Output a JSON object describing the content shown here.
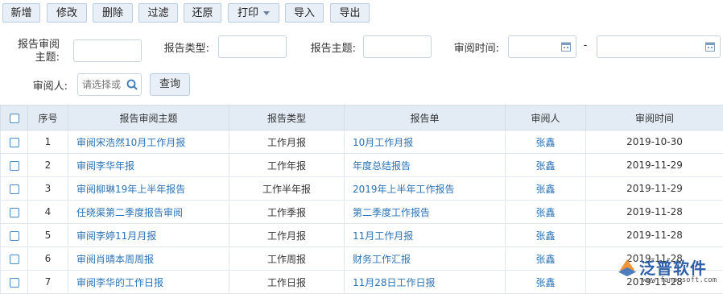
{
  "toolbar": {
    "buttons": [
      "新增",
      "修改",
      "删除",
      "过滤",
      "还原",
      "打印",
      "导入",
      "导出"
    ]
  },
  "filters": {
    "subject_label": "报告审阅主题:",
    "type_label": "报告类型:",
    "topic_label": "报告主题:",
    "time_label": "审阅时间:",
    "range_sep": "-",
    "reviewer_label": "审阅人:",
    "reviewer_placeholder": "请选择或",
    "query_button": "查询"
  },
  "table": {
    "headers": [
      "序号",
      "报告审阅主题",
      "报告类型",
      "报告单",
      "审阅人",
      "审阅时间"
    ],
    "rows": [
      {
        "no": "1",
        "subject": "审阅宋浩然10月工作月报",
        "type": "工作月报",
        "report": "10月工作月报",
        "reviewer": "张鑫",
        "time": "2019-10-30"
      },
      {
        "no": "2",
        "subject": "审阅李华年报",
        "type": "工作年报",
        "report": "年度总结报告",
        "reviewer": "张鑫",
        "time": "2019-11-29"
      },
      {
        "no": "3",
        "subject": "审阅柳琳19年上半年报告",
        "type": "工作半年报",
        "report": "2019年上半年工作报告",
        "reviewer": "张鑫",
        "time": "2019-11-29"
      },
      {
        "no": "4",
        "subject": "任晓渠第二季度报告审阅",
        "type": "工作季报",
        "report": "第二季度工作报告",
        "reviewer": "张鑫",
        "time": "2019-11-28"
      },
      {
        "no": "5",
        "subject": "审阅李婷11月月报",
        "type": "工作月报",
        "report": "11月工作月报",
        "reviewer": "张鑫",
        "time": "2019-11-28"
      },
      {
        "no": "6",
        "subject": "审阅肖晴本周周报",
        "type": "工作周报",
        "report": "财务工作汇报",
        "reviewer": "张鑫",
        "time": "2019-11-28"
      },
      {
        "no": "7",
        "subject": "审阅李华的工作日报",
        "type": "工作日报",
        "report": "11月28日工作日报",
        "reviewer": "张鑫",
        "time": "2019-11-28"
      }
    ]
  },
  "watermark": {
    "name": "泛普软件",
    "url": "www.fanpusoft.com"
  },
  "colors": {
    "link": "#2a73b6",
    "header_bg": "#e3ecf5",
    "button_bg": "#e8eff7"
  }
}
